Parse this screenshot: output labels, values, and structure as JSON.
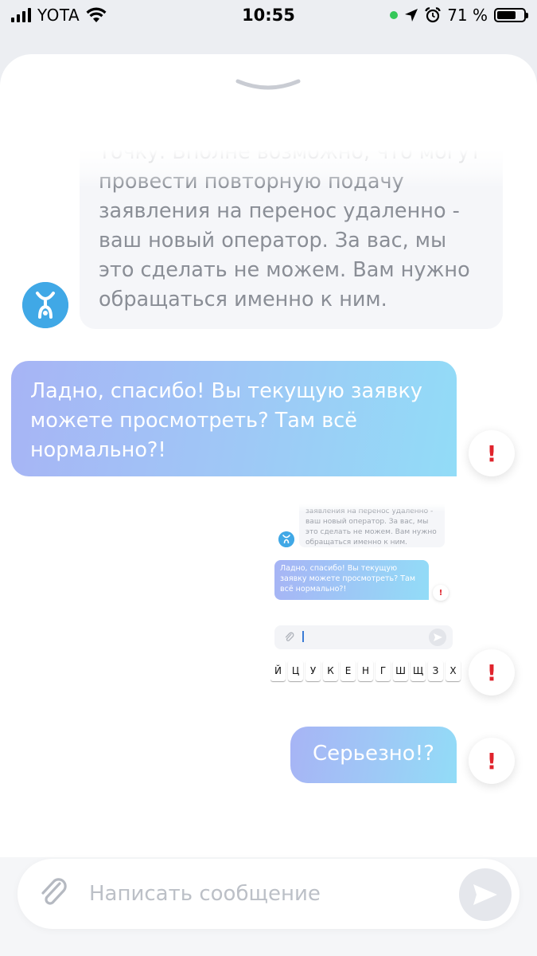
{
  "status_bar": {
    "carrier": "YOTA",
    "time": "10:55",
    "battery_percent": "71 %",
    "battery_level": 0.71,
    "icons": [
      "signal-icon",
      "wifi-icon",
      "green-dot-icon",
      "location-icon",
      "alarm-icon",
      "battery-icon"
    ]
  },
  "chat": {
    "messages": [
      {
        "direction": "incoming",
        "text": "точку. Вполне возможно, что могут провести повторную подачу заявления на перенос удаленно - ваш новый оператор. За вас, мы это сделать не можем. Вам нужно обращаться именно к ним."
      },
      {
        "direction": "outgoing",
        "text": "Ладно, спасибо! Вы текущую заявку можете просмотреть? Там всё нормально?!",
        "status": "!"
      },
      {
        "direction": "outgoing",
        "type": "image",
        "status": "!",
        "image": {
          "incoming_text": "заявления на перенос удаленно - ваш новый оператор. За вас, мы это сделать не можем. Вам нужно обращаться именно к ним.",
          "outgoing_text": "Ладно, спасибо! Вы текущую заявку можете просмотреть? Там всё нормально?!",
          "outgoing_status": "!",
          "keyboard_keys": [
            "Й",
            "Ц",
            "У",
            "К",
            "Е",
            "Н",
            "Г",
            "Ш",
            "Щ",
            "З",
            "Х"
          ]
        }
      },
      {
        "direction": "outgoing",
        "text": "Серьезно!?",
        "status": "!"
      }
    ]
  },
  "composer": {
    "placeholder": "Написать сообщение",
    "value": ""
  },
  "colors": {
    "bubble_out_start": "#a7b4f5",
    "bubble_out_end": "#92dcf7",
    "bubble_in_bg": "#f5f6f9",
    "bubble_in_text": "#8a8e96",
    "error": "#e0232c",
    "avatar": "#40a8e6"
  }
}
